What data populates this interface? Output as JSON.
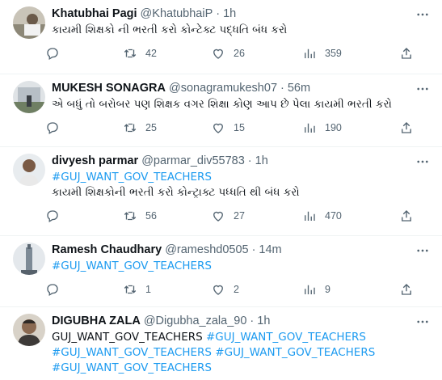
{
  "tweets": [
    {
      "name": "Khatubhai Pagi",
      "handle": "@KhatubhaiP",
      "time": "1h",
      "lines": [
        "કાયમી શિક્ષકો ની ભરતી કરો કોન્ટેક્ટ પદ્ધતિ બંધ કરો"
      ],
      "replies": "",
      "retweets": "42",
      "likes": "26",
      "views": "359"
    },
    {
      "name": "MUKESH SONAGRA",
      "handle": "@sonagramukesh07",
      "time": "56m",
      "lines": [
        "એ બધું તો બરોબર પણ શિક્ષક વગર શિક્ષા કોણ આપ છે પેલા કાયમી ભરતી કરો"
      ],
      "replies": "",
      "retweets": "25",
      "likes": "15",
      "views": "190"
    },
    {
      "name": "divyesh parmar",
      "handle": "@parmar_div55783",
      "time": "1h",
      "hashtag": "#GUJ_WANT_GOV_TEACHERS",
      "lines": [
        "કાયમી શિક્ષકોની ભરતી કરો કોન્ટ્રાક્ટ પધ્ધતિ થી બંધ કરો"
      ],
      "replies": "",
      "retweets": "56",
      "likes": "27",
      "views": "470"
    },
    {
      "name": "Ramesh Chaudhary",
      "handle": "@rameshd0505",
      "time": "14m",
      "hashtag": "#GUJ_WANT_GOV_TEACHERS",
      "replies": "",
      "retweets": "1",
      "likes": "2",
      "views": "9"
    },
    {
      "name": "DIGUBHA ZALA",
      "handle": "@Digubha_zala_90",
      "time": "1h",
      "plain_prefix": "GUJ_WANT_GOV_TEACHERS ",
      "hashtag": "#GUJ_WANT_GOV_TEACHERS",
      "hashtag_line2a": "#GUJ_WANT_GOV_TEACHERS",
      "hashtag_line2b": "#GUJ_WANT_GOV_TEACHERS",
      "hashtag_line3": "#GUJ_WANT_GOV_TEACHERS"
    }
  ],
  "separator": "·",
  "colors": {
    "link": "#1d9bf0",
    "muted": "#536471",
    "text": "#0f1419",
    "divider": "#eff3f4"
  }
}
